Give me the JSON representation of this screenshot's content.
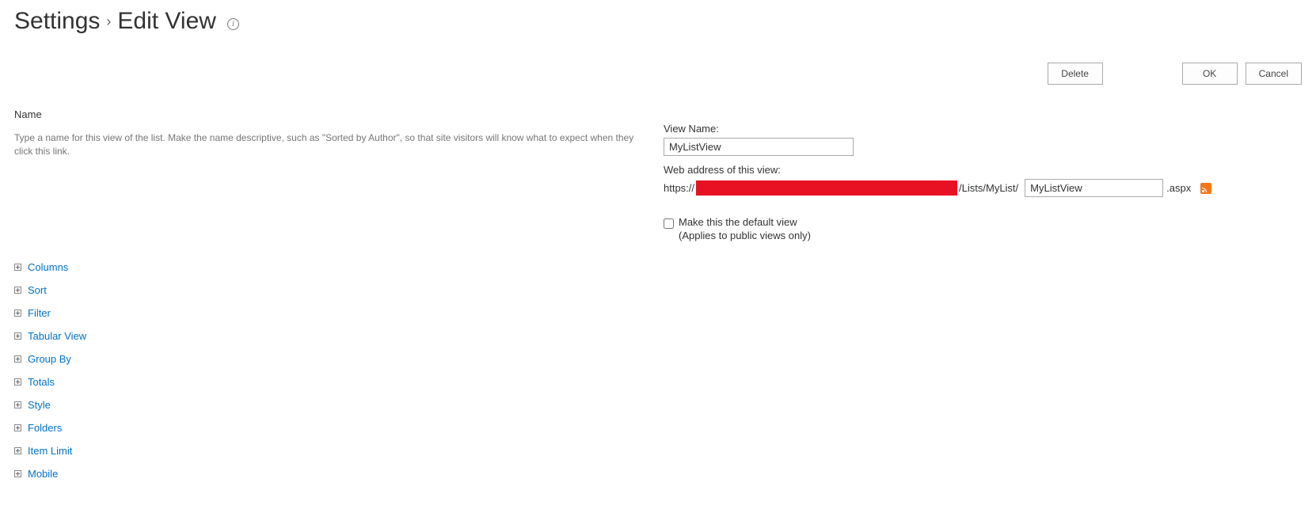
{
  "header": {
    "breadcrumb_parent": "Settings",
    "breadcrumb_current": "Edit View",
    "separator": "›"
  },
  "buttons": {
    "delete": "Delete",
    "ok": "OK",
    "cancel": "Cancel"
  },
  "name_section": {
    "title": "Name",
    "description": "Type a name for this view of the list. Make the name descriptive, such as \"Sorted by Author\", so that site visitors will know what to expect when they click this link.",
    "view_name_label": "View Name:",
    "view_name_value": "MyListView",
    "web_address_label": "Web address of this view:",
    "url_prefix": "https://",
    "url_mid": "/Lists/MyList/",
    "url_slug_value": "MyListView",
    "url_suffix": ".aspx",
    "default_checkbox_label": "Make this the default view",
    "default_checkbox_sub": "(Applies to public views only)"
  },
  "sections": [
    {
      "label": "Columns"
    },
    {
      "label": "Sort"
    },
    {
      "label": "Filter"
    },
    {
      "label": "Tabular View"
    },
    {
      "label": "Group By"
    },
    {
      "label": "Totals"
    },
    {
      "label": "Style"
    },
    {
      "label": "Folders"
    },
    {
      "label": "Item Limit"
    },
    {
      "label": "Mobile"
    }
  ]
}
